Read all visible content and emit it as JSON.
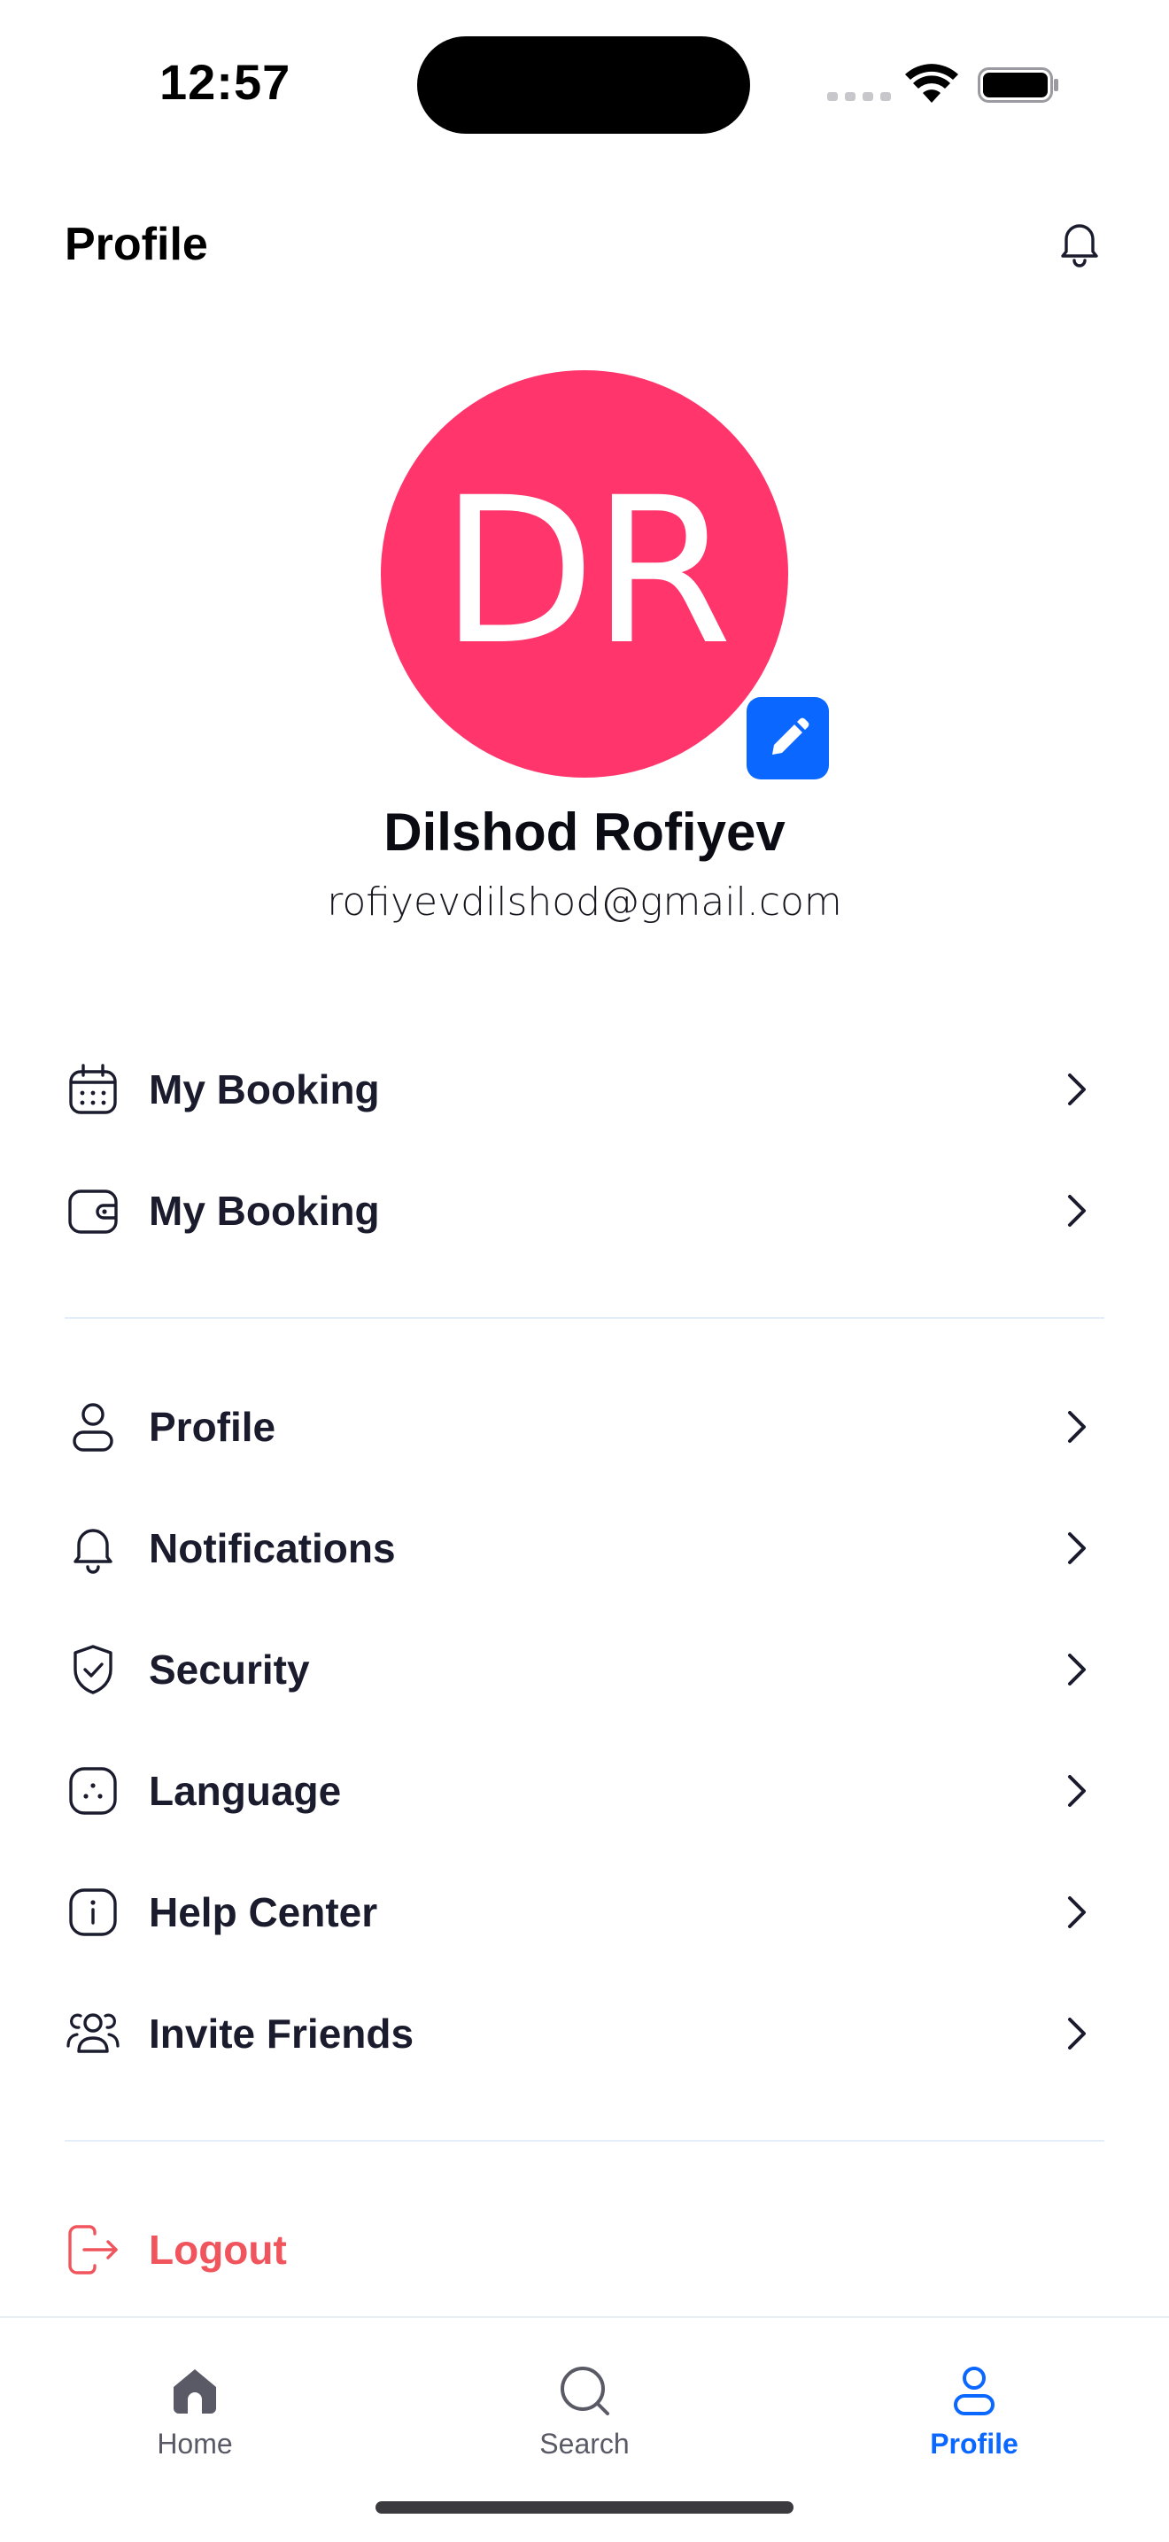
{
  "status_bar": {
    "time": "12:57"
  },
  "header": {
    "title": "Profile"
  },
  "profile": {
    "initials": "DR",
    "avatar_color": "#ff356b",
    "name": "Dilshod Rofiyev",
    "email": "rofiyevdilshod@gmail.com"
  },
  "menu_groups": [
    [
      {
        "label": "My Booking",
        "icon": "calendar-icon"
      },
      {
        "label": "My Booking",
        "icon": "wallet-icon"
      }
    ],
    [
      {
        "label": "Profile",
        "icon": "user-icon"
      },
      {
        "label": "Notifications",
        "icon": "bell-icon"
      },
      {
        "label": "Security",
        "icon": "shield-check-icon"
      },
      {
        "label": "Language",
        "icon": "language-icon"
      },
      {
        "label": "Help Center",
        "icon": "info-icon"
      },
      {
        "label": "Invite Friends",
        "icon": "users-icon"
      }
    ]
  ],
  "logout": {
    "label": "Logout",
    "color": "#f0545c"
  },
  "bottom_nav": [
    {
      "label": "Home",
      "icon": "home-icon",
      "active": false
    },
    {
      "label": "Search",
      "icon": "search-icon",
      "active": false
    },
    {
      "label": "Profile",
      "icon": "user-icon",
      "active": true
    }
  ],
  "accent_color": "#0a67ff"
}
